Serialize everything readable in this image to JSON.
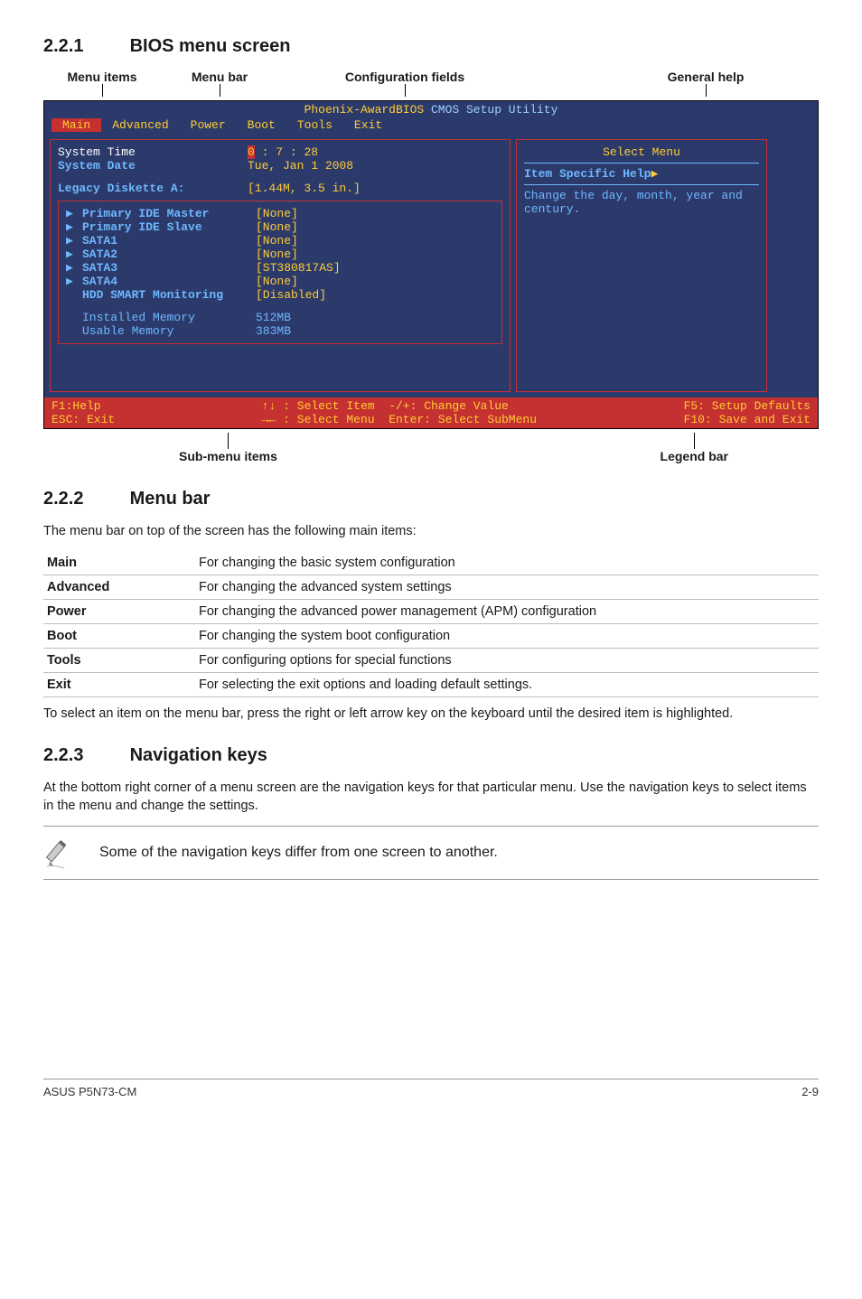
{
  "sections": {
    "s1": {
      "num": "2.2.1",
      "title": "BIOS menu screen"
    },
    "s2": {
      "num": "2.2.2",
      "title": "Menu bar"
    },
    "s3": {
      "num": "2.2.3",
      "title": "Navigation keys"
    }
  },
  "top_labels": {
    "menu_items": "Menu items",
    "menu_bar": "Menu bar",
    "config_fields": "Configuration fields",
    "general_help": "General help"
  },
  "bios": {
    "title_left": "Phoenix-AwardBIOS",
    "title_right": " CMOS Setup Utility",
    "tabs": [
      "Main",
      "Advanced",
      "Power",
      "Boot",
      "Tools",
      "Exit"
    ],
    "rows": {
      "system_time": {
        "k": "System Time",
        "v_h": "0",
        "v_sep": " : ",
        "v_m": "7",
        "v_s": "28"
      },
      "system_date": {
        "k": "System Date",
        "v": "Tue, Jan   1 2008"
      },
      "legacy": {
        "k": "Legacy Diskette A:",
        "v": "[1.44M, 3.5 in.]"
      }
    },
    "group": [
      {
        "k": "Primary IDE Master",
        "v": "[None]"
      },
      {
        "k": "Primary IDE Slave",
        "v": "[None]"
      },
      {
        "k": "SATA1",
        "v": "[None]"
      },
      {
        "k": "SATA2",
        "v": "[None]"
      },
      {
        "k": "SATA3",
        "v": "[ST380817AS]"
      },
      {
        "k": "SATA4",
        "v": "[None]"
      },
      {
        "k": "HDD SMART Monitoring",
        "v": "[Disabled]"
      }
    ],
    "mem": {
      "installed": {
        "k": "Installed Memory",
        "v": "512MB"
      },
      "usable": {
        "k": "Usable Memory",
        "v": "383MB"
      }
    },
    "right": {
      "title": "Select Menu",
      "help_label": "Item Specific Help",
      "help_body": "Change the day, month, year and century."
    },
    "footer": {
      "c1a": "F1:Help",
      "c1b": "ESC: Exit",
      "c2a": "↑↓ : Select Item  -/+: Change Value",
      "c2b": "→← : Select Menu  Enter: Select SubMenu",
      "c3a": "F5: Setup Defaults",
      "c3b": "F10: Save and Exit"
    }
  },
  "bottom_labels": {
    "submenu": "Sub-menu items",
    "legend": "Legend bar"
  },
  "menu_bar_text": "The menu bar on top of the screen has the following main items:",
  "defs": [
    {
      "k": "Main",
      "v": "For changing the basic system configuration"
    },
    {
      "k": "Advanced",
      "v": "For changing the advanced system settings"
    },
    {
      "k": "Power",
      "v": "For changing the advanced power management (APM) configuration"
    },
    {
      "k": "Boot",
      "v": "For changing the system boot configuration"
    },
    {
      "k": "Tools",
      "v": "For configuring options for special functions"
    },
    {
      "k": "Exit",
      "v": "For selecting the exit options and loading default settings."
    }
  ],
  "menu_bar_after": "To select an item on the menu bar, press the right or left arrow key on the keyboard until the desired item is highlighted.",
  "nav_text": "At the bottom right corner of a menu screen are the navigation keys for that particular menu. Use the navigation keys to select items in the menu and change the settings.",
  "note_text": "Some of the navigation keys differ from one screen to another.",
  "footer": {
    "left": "ASUS P5N73-CM",
    "right": "2-9"
  }
}
